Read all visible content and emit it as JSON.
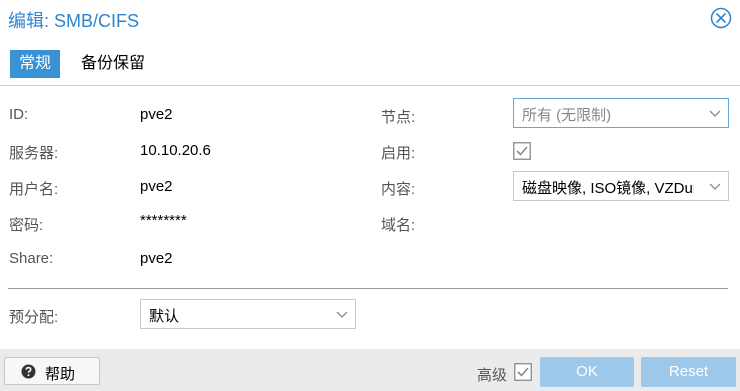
{
  "window": {
    "title": "编辑: SMB/CIFS"
  },
  "tabs": [
    {
      "label": "常规",
      "active": true
    },
    {
      "label": "备份保留",
      "active": false
    }
  ],
  "form": {
    "id": {
      "label": "ID:",
      "value": "pve2"
    },
    "server": {
      "label": "服务器:",
      "value": "10.10.20.6"
    },
    "username": {
      "label": "用户名:",
      "value": "pve2"
    },
    "password": {
      "label": "密码:",
      "value": "********"
    },
    "share": {
      "label": "Share:",
      "value": "pve2"
    },
    "nodes": {
      "label": "节点:",
      "value": "所有 (无限制)"
    },
    "enable": {
      "label": "启用:",
      "checked": true
    },
    "content": {
      "label": "内容:",
      "value": "磁盘映像, ISO镜像, VZDump备份文件"
    },
    "domain": {
      "label": "域名:",
      "value": ""
    },
    "preallocation": {
      "label": "预分配:",
      "value": "默认"
    }
  },
  "footer": {
    "help_label": "帮助",
    "advanced_label": "高级",
    "advanced_checked": true,
    "ok_label": "OK",
    "reset_label": "Reset"
  },
  "colors": {
    "accent": "#3892d4",
    "title": "#2f84d0",
    "disabled_button": "#9ec8ea"
  }
}
